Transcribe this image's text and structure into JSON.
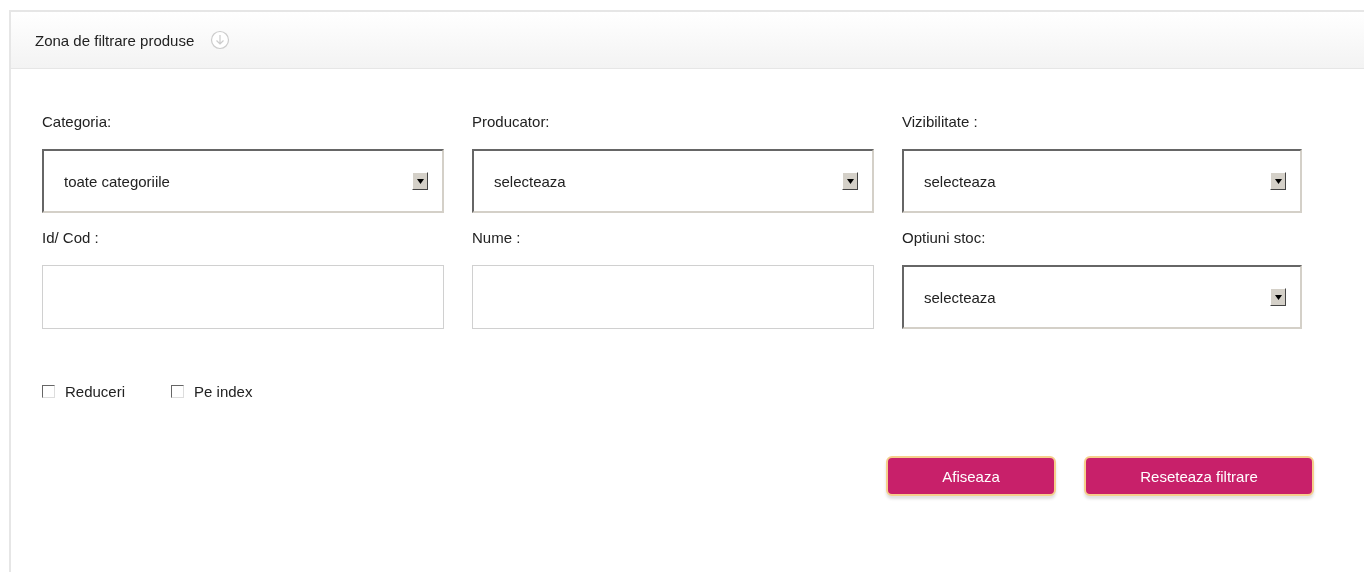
{
  "panel": {
    "title": "Zona de filtrare produse"
  },
  "fields": [
    {
      "label": "Categoria:",
      "kind": "select",
      "value": "toate categoriile"
    },
    {
      "label": "Producator:",
      "kind": "select",
      "value": "selecteaza"
    },
    {
      "label": "Vizibilitate :",
      "kind": "select",
      "value": "selecteaza"
    },
    {
      "label": "Id/ Cod :",
      "kind": "text"
    },
    {
      "label": "Nume :",
      "kind": "text"
    },
    {
      "label": "Optiuni stoc:",
      "kind": "select",
      "value": "selecteaza"
    }
  ],
  "checkboxes": [
    {
      "label": "Reduceri",
      "checked": false
    },
    {
      "label": "Pe index",
      "checked": false
    }
  ],
  "buttons": [
    "Afiseaza",
    "Reseteaza filtrare"
  ]
}
